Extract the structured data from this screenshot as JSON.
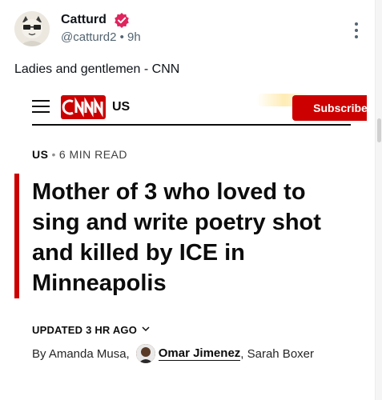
{
  "post": {
    "display_name": "Catturd",
    "handle": "@catturd2",
    "separator": "•",
    "time": "9h",
    "text": "Ladies and gentlemen - CNN"
  },
  "card": {
    "edition": "US",
    "subscribe_label": "Subscribe",
    "section": "US",
    "section_sep": "•",
    "read_time": "6 MIN READ",
    "headline": "Mother of 3 who loved to sing and write poetry shot and killed by ICE in Minneapolis",
    "updated": "UPDATED 3 HR AGO",
    "byline_prefix": "By Amanda Musa,",
    "author_linked": "Omar Jimenez",
    "byline_suffix": ", Sarah Boxer"
  },
  "colors": {
    "cnn_red": "#cc0000",
    "verified": "#e0245e",
    "text_muted": "#536471"
  },
  "icons": [
    "avatar",
    "verified-icon",
    "more-icon",
    "hamburger-icon",
    "cnn-logo-icon",
    "chevron-down-icon"
  ]
}
